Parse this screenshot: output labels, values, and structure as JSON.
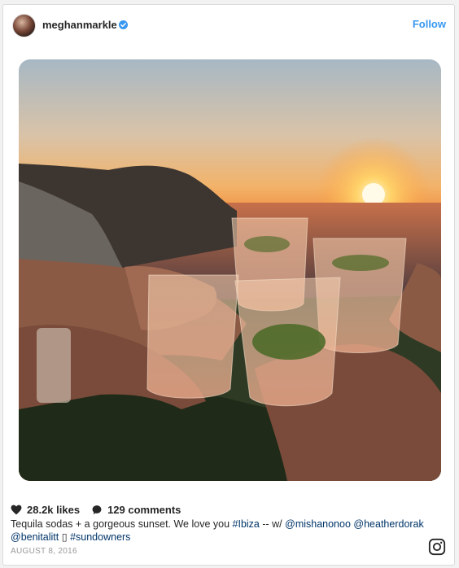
{
  "post": {
    "username": "meghanmarkle",
    "follow_label": "Follow",
    "likes": "28.2k likes",
    "comments": "129 comments",
    "caption_text": "Tequila sodas + a gorgeous sunset. We love you ",
    "caption_tags": [
      "#Ibiza",
      " -- w/ ",
      "@mishanonoo",
      " ",
      "@heatherdorak"
    ],
    "caption_line2_tags": [
      "@benitalitt",
      " ▯ ",
      "#sundowners"
    ],
    "date": "AUGUST 8, 2016"
  },
  "icons": {
    "avatar": "profile-avatar",
    "verified": "verified-badge-icon",
    "like": "heart-icon",
    "comment": "comment-bubble-icon",
    "brand": "instagram-icon"
  },
  "colors": {
    "accent": "#3897f0",
    "text": "#262626",
    "muted": "#999999",
    "tag": "#003569"
  }
}
